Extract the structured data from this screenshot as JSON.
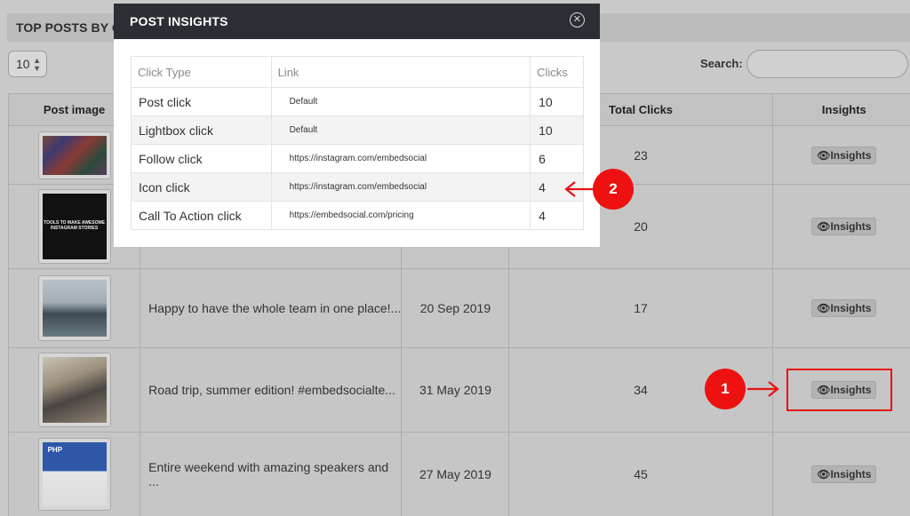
{
  "panel": {
    "title": "TOP POSTS BY CL"
  },
  "controls": {
    "page_size": "10",
    "search_label": "Search:",
    "search_value": ""
  },
  "table": {
    "headers": {
      "image": "Post image",
      "total_clicks": "Total Clicks",
      "insights": "Insights"
    },
    "rows": [
      {
        "caption": "",
        "date": "",
        "clicks": "23",
        "insights": "Insights"
      },
      {
        "caption": "",
        "date": "",
        "clicks": "20",
        "insights": "Insights",
        "thumb_text": "TOOLS TO MAKE AWESOME INSTAGRAM STORIES"
      },
      {
        "caption": "Happy to have the whole team in one place!...",
        "date": "20 Sep 2019",
        "clicks": "17",
        "insights": "Insights"
      },
      {
        "caption": "Road trip, summer edition! #embedsocialte...",
        "date": "31 May 2019",
        "clicks": "34",
        "insights": "Insights"
      },
      {
        "caption": "Entire weekend with amazing speakers and ...",
        "date": "27 May 2019",
        "clicks": "45",
        "insights": "Insights",
        "thumb_text": "PHP"
      }
    ]
  },
  "modal": {
    "title": "POST INSIGHTS",
    "headers": {
      "type": "Click Type",
      "link": "Link",
      "clicks": "Clicks"
    },
    "rows": [
      {
        "type": "Post click",
        "link": "Default",
        "clicks": "10"
      },
      {
        "type": "Lightbox click",
        "link": "Default",
        "clicks": "10"
      },
      {
        "type": "Follow click",
        "link": "https://instagram.com/embedsocial",
        "clicks": "6"
      },
      {
        "type": "Icon click",
        "link": "https://instagram.com/embedsocial",
        "clicks": "4"
      },
      {
        "type": "Call To Action click",
        "link": "https://embedsocial.com/pricing",
        "clicks": "4"
      }
    ]
  },
  "annotations": {
    "step1": "1",
    "step2": "2",
    "accent_color": "#ee1111"
  }
}
